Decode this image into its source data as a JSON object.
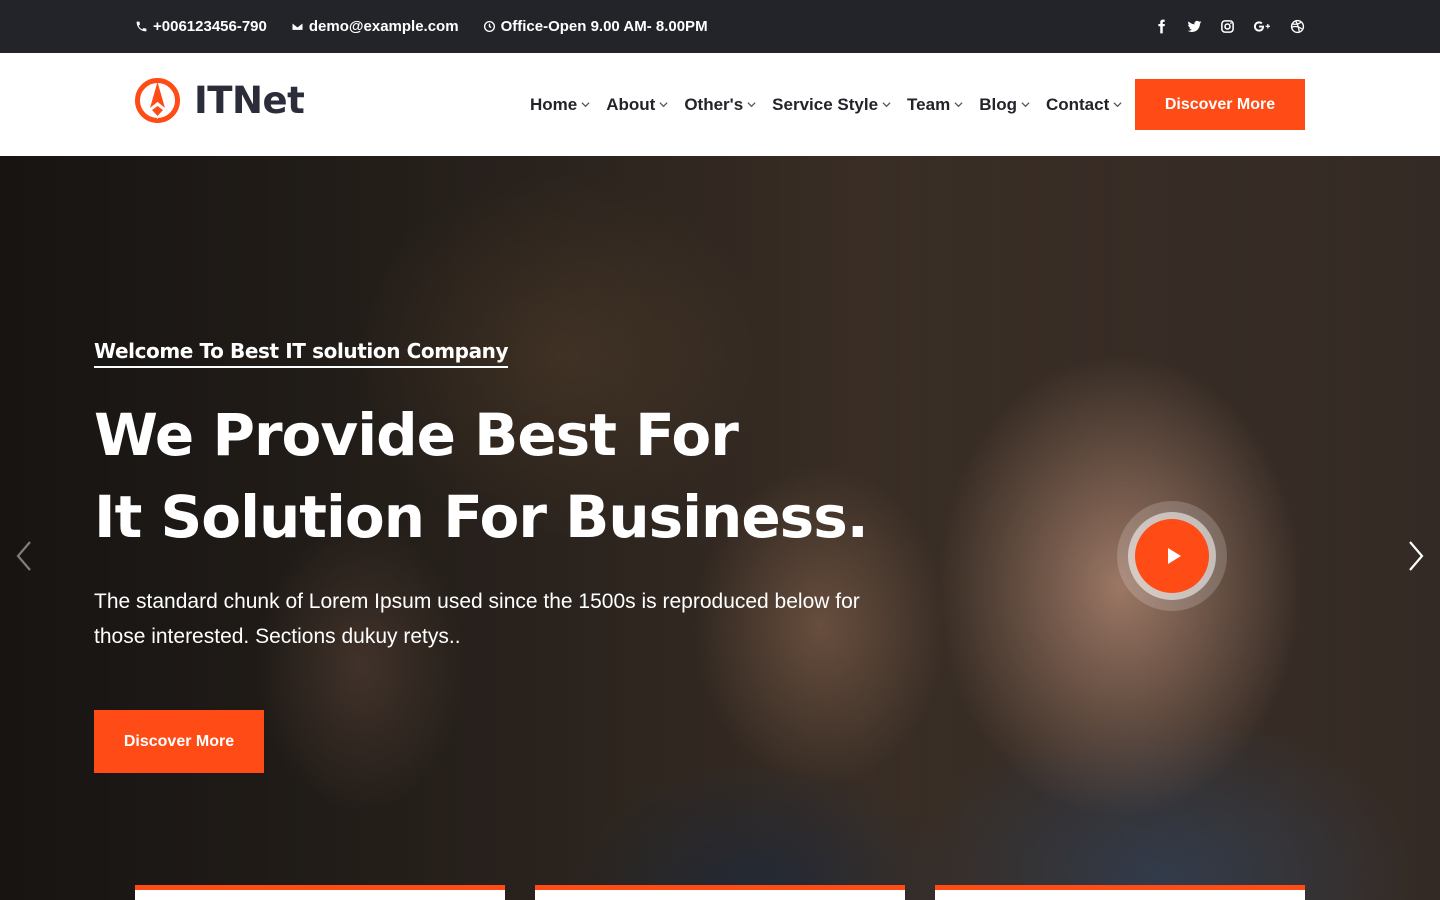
{
  "topbar": {
    "phone": "+006123456-790",
    "email": "demo@example.com",
    "hours": "Office-Open 9.00 AM- 8.00PM",
    "social": [
      "facebook-icon",
      "twitter-icon",
      "instagram-icon",
      "google-plus-icon",
      "dribbble-icon"
    ]
  },
  "header": {
    "logo_text": "ITNet",
    "nav": [
      "Home",
      "About",
      "Other's",
      "Service Style",
      "Team",
      "Blog",
      "Contact"
    ],
    "cta_label": "Discover More"
  },
  "hero": {
    "welcome": "Welcome To Best IT solution Company",
    "headline_line1": "We Provide Best For",
    "headline_line2": "It Solution For Business.",
    "lead": "The standard chunk of Lorem Ipsum used since the 1500s is reproduced below for those interested. Sections dukuy retys..",
    "cta_label": "Discover More"
  },
  "colors": {
    "accent": "#ff4b16",
    "topbar_bg": "#22242a",
    "text_dark": "#22242a"
  }
}
